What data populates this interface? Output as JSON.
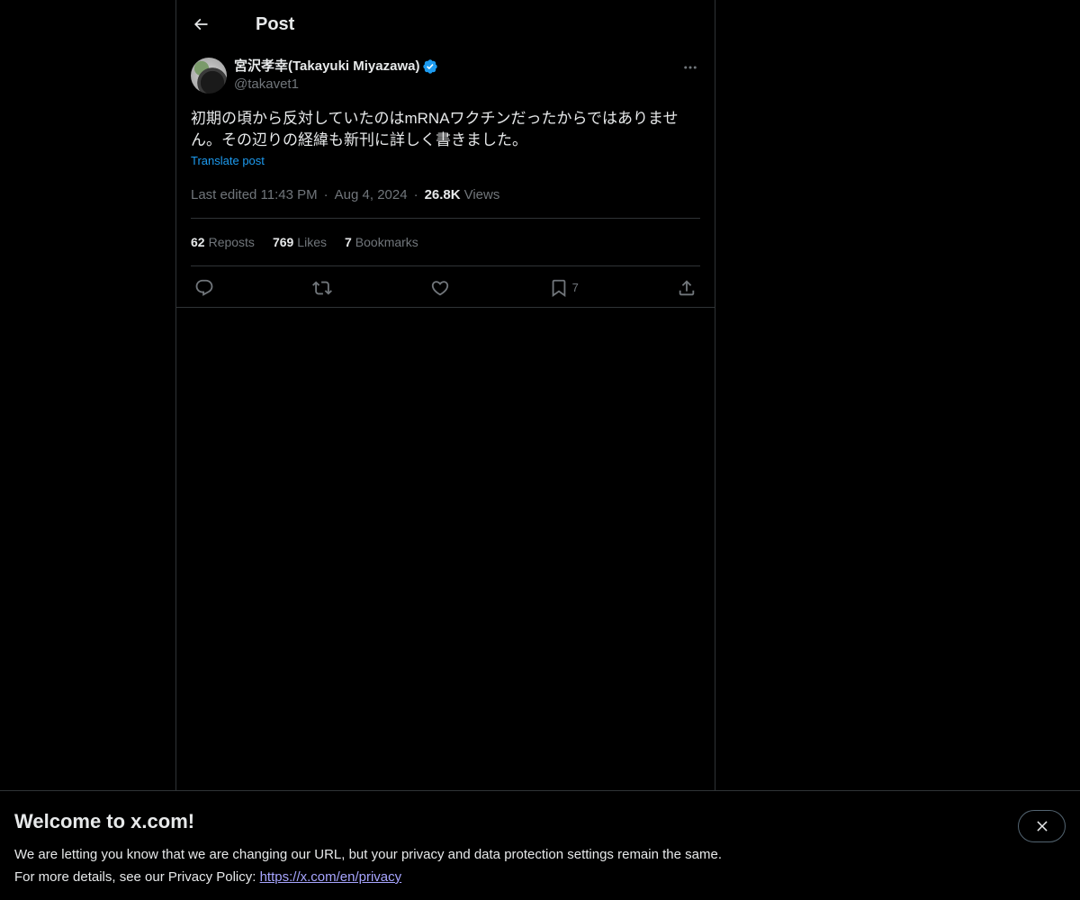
{
  "header": {
    "title": "Post"
  },
  "post": {
    "author": {
      "display_name": "宮沢孝幸(Takayuki Miyazawa)",
      "handle": "@takavet1",
      "verified": true
    },
    "text_line1": "初期の頃から反対していたのはmRNAワクチンだったからではありませ",
    "text_line2": "ん。その辺りの経緯も新刊に詳しく書きました。",
    "translate_label": "Translate post",
    "meta": {
      "edited_time": "Last edited 11:43 PM",
      "date": "Aug 4, 2024",
      "views_count": "26.8K",
      "views_label": "Views",
      "separator": "·"
    },
    "stats": {
      "reposts_count": "62",
      "reposts_label": "Reposts",
      "likes_count": "769",
      "likes_label": "Likes",
      "bookmarks_count": "7",
      "bookmarks_label": "Bookmarks"
    },
    "actions": {
      "bookmark_count": "7"
    }
  },
  "banner": {
    "title": "Welcome to x.com!",
    "line1": "We are letting you know that we are changing our URL, but your privacy and data protection settings remain the same.",
    "line2_prefix": "For more details, see our Privacy Policy: ",
    "link": "https://x.com/en/privacy"
  },
  "colors": {
    "background": "#000000",
    "text": "#e7e9ea",
    "muted": "#71767b",
    "accent": "#1d9bf0",
    "border": "#2f3336",
    "link": "#a7a5ff"
  },
  "icons": [
    "back-arrow-icon",
    "verified-badge-icon",
    "more-icon",
    "reply-icon",
    "repost-icon",
    "like-icon",
    "bookmark-icon",
    "share-icon",
    "close-icon"
  ]
}
